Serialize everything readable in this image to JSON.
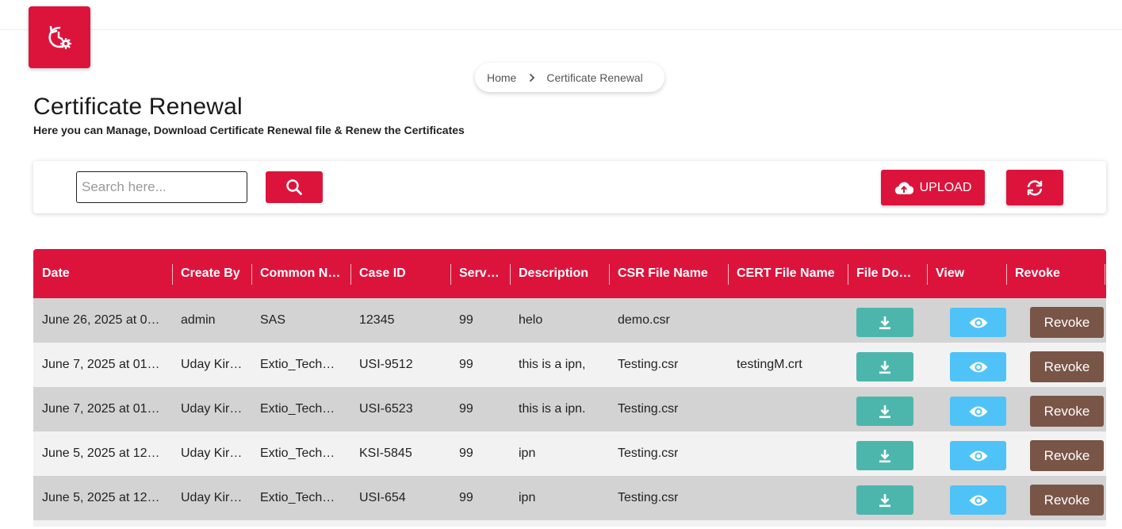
{
  "breadcrumb": {
    "home": "Home",
    "current": "Certificate Renewal"
  },
  "page": {
    "title": "Certificate Renewal",
    "subtitle": "Here you can Manage, Download Certificate Renewal file & Renew the Certificates"
  },
  "toolbar": {
    "search_placeholder": "Search here...",
    "upload_label": "UPLOAD"
  },
  "colors": {
    "accent": "#dc143c",
    "download": "#4db6ac",
    "view": "#4fc3f7",
    "revoke": "#795548"
  },
  "icons": {
    "logo": "history-settings-icon",
    "search": "search-icon",
    "upload": "cloud-upload-icon",
    "refresh": "refresh-icon",
    "download": "download-icon",
    "view": "eye-icon",
    "breadcrumb_sep": "chevron-right-icon"
  },
  "table": {
    "headers": [
      "Date",
      "Create By",
      "Common N…",
      "Case ID",
      "Serv…",
      "Description",
      "CSR File Name",
      "CERT File Name",
      "File Do…",
      "View",
      "Revoke"
    ],
    "revoke_label": "Revoke",
    "rows": [
      {
        "date": "June 26, 2025 at 0…",
        "created_by": "admin",
        "common_name": "SAS",
        "case_id": "12345",
        "serv": "99",
        "description": "helo",
        "csr": "demo.csr",
        "cert": ""
      },
      {
        "date": "June 7, 2025 at 01…",
        "created_by": "Uday Kir…",
        "common_name": "Extio_Tech…",
        "case_id": "USI-9512",
        "serv": "99",
        "description": "this is a ipn,",
        "csr": "Testing.csr",
        "cert": "testingM.crt"
      },
      {
        "date": "June 7, 2025 at 01…",
        "created_by": "Uday Kir…",
        "common_name": "Extio_Tech…",
        "case_id": "USI-6523",
        "serv": "99",
        "description": "this is a ipn.",
        "csr": "Testing.csr",
        "cert": ""
      },
      {
        "date": "June 5, 2025 at 12…",
        "created_by": "Uday Kir…",
        "common_name": "Extio_Tech…",
        "case_id": "KSI-5845",
        "serv": "99",
        "description": "ipn",
        "csr": "Testing.csr",
        "cert": ""
      },
      {
        "date": "June 5, 2025 at 12…",
        "created_by": "Uday Kir…",
        "common_name": "Extio_Tech…",
        "case_id": "USI-654",
        "serv": "99",
        "description": "ipn",
        "csr": "Testing.csr",
        "cert": ""
      }
    ]
  }
}
